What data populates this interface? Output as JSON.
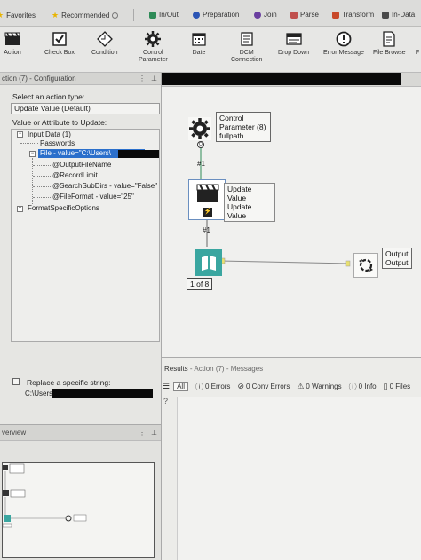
{
  "categories": [
    {
      "label": "Favorites",
      "color": "#e8b400",
      "shape": "star"
    },
    {
      "label": "Recommended",
      "color": "#e8b400",
      "shape": "star"
    },
    {
      "label": "In/Out",
      "color": "#2e8b57",
      "shape": "square"
    },
    {
      "label": "Preparation",
      "color": "#2b55b5",
      "shape": "circle"
    },
    {
      "label": "Join",
      "color": "#6a3fa0",
      "shape": "circle"
    },
    {
      "label": "Parse",
      "color": "#c0504d",
      "shape": "square"
    },
    {
      "label": "Transform",
      "color": "#c8492a",
      "shape": "square"
    },
    {
      "label": "In-Data",
      "color": "#4a4a4a",
      "shape": "square"
    }
  ],
  "tools": [
    {
      "label": "Action",
      "icon": "clapperboard-icon"
    },
    {
      "label": "Check Box",
      "icon": "checkbox-icon"
    },
    {
      "label": "Condition",
      "icon": "condition-icon"
    },
    {
      "label": "Control\nParameter",
      "icon": "gear-icon"
    },
    {
      "label": "Date",
      "icon": "calendar-icon"
    },
    {
      "label": "DCM\nConnection",
      "icon": "dcm-icon"
    },
    {
      "label": "Drop Down",
      "icon": "dropdown-icon"
    },
    {
      "label": "Error Message",
      "icon": "error-icon"
    },
    {
      "label": "File Browse",
      "icon": "file-browse-icon"
    },
    {
      "label": "F",
      "icon": "folder-icon"
    }
  ],
  "config": {
    "title": "ction (7) - Configuration",
    "action_type_label": "Select an action type:",
    "action_type_value": "Update Value (Default)",
    "attribute_label": "Value or Attribute to Update:",
    "tree": {
      "input_data": "Input Data (1)",
      "passwords": "Passwords",
      "file": "File - value=\"C:\\Users\\",
      "output_file_name": "@OutputFileName",
      "record_limit": "@RecordLimit",
      "search_subdirs": "@SearchSubDirs - value=\"False\"",
      "file_format": "@FileFormat - value=\"25\"",
      "format_specific": "FormatSpecificOptions"
    },
    "replace_label": "Replace a specific string:",
    "replace_value": "C:\\Users\\"
  },
  "overview": {
    "title": "verview"
  },
  "canvas": {
    "control_param": "Control\nParameter (8)\nfullpath",
    "update_value": "Update Value\nUpdate Value",
    "conn1": "#1",
    "conn2": "#1",
    "browse_count": "1 of 8",
    "output": "Output\nOutput"
  },
  "results": {
    "title": "Results",
    "subtitle": " - Action (7) - Messages",
    "filters": [
      {
        "label": "All",
        "icon": "list-icon",
        "active": true
      },
      {
        "label": "0 Errors",
        "icon": "error-circle-icon"
      },
      {
        "label": "0 Conv Errors",
        "icon": "conv-error-icon"
      },
      {
        "label": "0 Warnings",
        "icon": "warning-icon"
      },
      {
        "label": "0 Info",
        "icon": "info-icon"
      },
      {
        "label": "0 Files",
        "icon": "file-icon"
      }
    ]
  },
  "colors": {
    "selection": "#2b6fcb",
    "canvas_bg": "#f0f0ee",
    "connector_green": "#2e8b57",
    "browse_teal": "#3aa6a0"
  }
}
